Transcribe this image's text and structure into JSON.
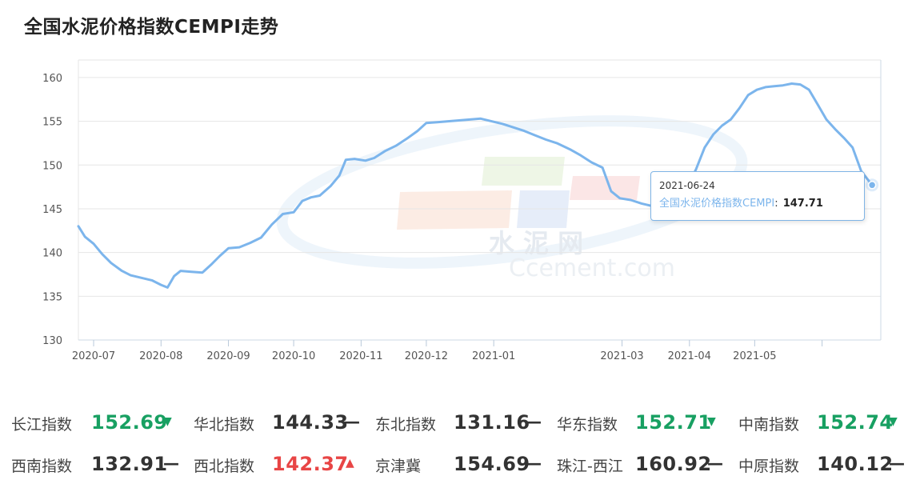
{
  "title": "全国水泥价格指数CEMPI走势",
  "watermark": {
    "cn": "水 泥 网",
    "en": "Ccement.com"
  },
  "tooltip": {
    "date": "2021-06-24",
    "series_name": "全国水泥价格指数CEMPI",
    "value": "147.71"
  },
  "colors": {
    "line": "#7cb5ec",
    "grid": "#e6e6e6",
    "up": "#e84545",
    "down": "#18a062"
  },
  "chart_data": {
    "type": "line",
    "ylim": [
      130,
      162
    ],
    "yticks": [
      130,
      135,
      140,
      145,
      150,
      155,
      160
    ],
    "xticks": [
      {
        "label": "2020-07",
        "date": "2020-07-01"
      },
      {
        "label": "2020-08",
        "date": "2020-08-01"
      },
      {
        "label": "2020-09",
        "date": "2020-09-01"
      },
      {
        "label": "2020-10",
        "date": "2020-10-01"
      },
      {
        "label": "2020-11",
        "date": "2020-11-01"
      },
      {
        "label": "2020-12",
        "date": "2020-12-01"
      },
      {
        "label": "2021-01",
        "date": "2021-01-01"
      },
      {
        "label": "2021-03",
        "date": "2021-03-01"
      },
      {
        "label": "2021-04",
        "date": "2021-04-01"
      },
      {
        "label": "2021-05",
        "date": "2021-05-01"
      },
      {
        "label": "",
        "date": "2021-06-01"
      }
    ],
    "xlim": [
      "2020-06-24",
      "2021-06-28"
    ],
    "series": [
      {
        "name": "全国水泥价格指数CEMPI",
        "points": [
          [
            "2020-06-24",
            143.0
          ],
          [
            "2020-06-27",
            141.8
          ],
          [
            "2020-07-01",
            141.0
          ],
          [
            "2020-07-05",
            139.8
          ],
          [
            "2020-07-09",
            138.8
          ],
          [
            "2020-07-14",
            137.9
          ],
          [
            "2020-07-18",
            137.4
          ],
          [
            "2020-07-23",
            137.1
          ],
          [
            "2020-07-28",
            136.8
          ],
          [
            "2020-08-01",
            136.3
          ],
          [
            "2020-08-04",
            136.0
          ],
          [
            "2020-08-07",
            137.3
          ],
          [
            "2020-08-10",
            137.9
          ],
          [
            "2020-08-15",
            137.8
          ],
          [
            "2020-08-20",
            137.7
          ],
          [
            "2020-08-24",
            138.6
          ],
          [
            "2020-08-28",
            139.6
          ],
          [
            "2020-09-01",
            140.5
          ],
          [
            "2020-09-06",
            140.6
          ],
          [
            "2020-09-11",
            141.1
          ],
          [
            "2020-09-16",
            141.7
          ],
          [
            "2020-09-21",
            143.2
          ],
          [
            "2020-09-26",
            144.4
          ],
          [
            "2020-10-01",
            144.6
          ],
          [
            "2020-10-05",
            145.9
          ],
          [
            "2020-10-09",
            146.3
          ],
          [
            "2020-10-13",
            146.5
          ],
          [
            "2020-10-18",
            147.6
          ],
          [
            "2020-10-22",
            148.8
          ],
          [
            "2020-10-25",
            150.6
          ],
          [
            "2020-10-29",
            150.7
          ],
          [
            "2020-11-03",
            150.5
          ],
          [
            "2020-11-07",
            150.8
          ],
          [
            "2020-11-12",
            151.6
          ],
          [
            "2020-11-17",
            152.2
          ],
          [
            "2020-11-22",
            153.0
          ],
          [
            "2020-11-27",
            153.9
          ],
          [
            "2020-12-01",
            154.8
          ],
          [
            "2020-12-06",
            154.9
          ],
          [
            "2020-12-11",
            155.0
          ],
          [
            "2020-12-16",
            155.1
          ],
          [
            "2020-12-21",
            155.2
          ],
          [
            "2020-12-26",
            155.3
          ],
          [
            "2020-12-31",
            155.0
          ],
          [
            "2021-01-05",
            154.7
          ],
          [
            "2021-01-10",
            154.3
          ],
          [
            "2021-01-15",
            153.9
          ],
          [
            "2021-01-20",
            153.4
          ],
          [
            "2021-01-25",
            152.9
          ],
          [
            "2021-01-30",
            152.5
          ],
          [
            "2021-02-05",
            151.8
          ],
          [
            "2021-02-10",
            151.1
          ],
          [
            "2021-02-15",
            150.3
          ],
          [
            "2021-02-20",
            149.7
          ],
          [
            "2021-02-24",
            147.0
          ],
          [
            "2021-02-28",
            146.2
          ],
          [
            "2021-03-05",
            146.0
          ],
          [
            "2021-03-10",
            145.6
          ],
          [
            "2021-03-15",
            145.3
          ],
          [
            "2021-03-20",
            145.0
          ],
          [
            "2021-03-25",
            145.2
          ],
          [
            "2021-03-30",
            147.0
          ],
          [
            "2021-04-04",
            149.5
          ],
          [
            "2021-04-08",
            152.0
          ],
          [
            "2021-04-12",
            153.5
          ],
          [
            "2021-04-16",
            154.5
          ],
          [
            "2021-04-20",
            155.2
          ],
          [
            "2021-04-24",
            156.5
          ],
          [
            "2021-04-28",
            158.0
          ],
          [
            "2021-05-02",
            158.6
          ],
          [
            "2021-05-06",
            158.9
          ],
          [
            "2021-05-10",
            159.0
          ],
          [
            "2021-05-14",
            159.1
          ],
          [
            "2021-05-18",
            159.3
          ],
          [
            "2021-05-22",
            159.2
          ],
          [
            "2021-05-26",
            158.6
          ],
          [
            "2021-05-30",
            156.9
          ],
          [
            "2021-06-03",
            155.2
          ],
          [
            "2021-06-07",
            154.1
          ],
          [
            "2021-06-11",
            153.1
          ],
          [
            "2021-06-15",
            152.0
          ],
          [
            "2021-06-19",
            149.3
          ],
          [
            "2021-06-24",
            147.71
          ]
        ]
      }
    ]
  },
  "indices": [
    [
      {
        "name": "长江指数",
        "value": "152.69",
        "trend": "down"
      },
      {
        "name": "华北指数",
        "value": "144.33",
        "trend": "flat"
      },
      {
        "name": "东北指数",
        "value": "131.16",
        "trend": "flat"
      },
      {
        "name": "华东指数",
        "value": "152.71",
        "trend": "down"
      },
      {
        "name": "中南指数",
        "value": "152.74",
        "trend": "down"
      }
    ],
    [
      {
        "name": "西南指数",
        "value": "132.91",
        "trend": "flat"
      },
      {
        "name": "西北指数",
        "value": "142.37",
        "trend": "up"
      },
      {
        "name": "京津冀",
        "value": "154.69",
        "trend": "flat"
      },
      {
        "name": "珠江-西江",
        "value": "160.92",
        "trend": "flat"
      },
      {
        "name": "中原指数",
        "value": "140.12",
        "trend": "flat"
      }
    ]
  ]
}
